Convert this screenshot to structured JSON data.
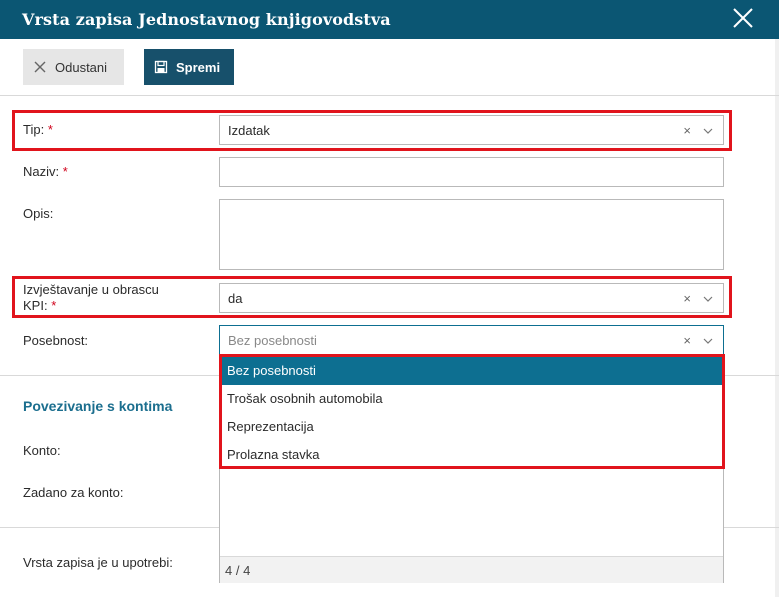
{
  "dialog": {
    "title": "Vrsta zapisa Jednostavnog knjigovodstva"
  },
  "toolbar": {
    "cancel_label": "Odustani",
    "save_label": "Spremi"
  },
  "form": {
    "tip": {
      "label": "Tip:",
      "required": "*",
      "value": "Izdatak",
      "clear": "×"
    },
    "naziv": {
      "label": "Naziv:",
      "required": "*",
      "value": ""
    },
    "opis": {
      "label": "Opis:",
      "value": ""
    },
    "kpi": {
      "label_line1": "Izvještavanje u obrascu",
      "label_line2": "KPI:",
      "required": "*",
      "value": "da",
      "clear": "×"
    },
    "posebnost": {
      "label": "Posebnost:",
      "placeholder": "Bez posebnosti",
      "clear": "×"
    }
  },
  "section": {
    "title": "Povezivanje s kontima",
    "konto_label": "Konto:",
    "zadano_label": "Zadano za konto:",
    "u_upotrebi_label": "Vrsta zapisa je u upotrebi:"
  },
  "dropdown": {
    "options": [
      "Bez posebnosti",
      "Trošak osobnih automobila",
      "Reprezentacija",
      "Prolazna stavka"
    ],
    "selected_index": 0,
    "footer": "4 / 4"
  },
  "colors": {
    "header_bg": "#0b5673",
    "save_bg": "#17506b",
    "accent": "#0d6f91",
    "highlight": "#e1141c",
    "required": "#d0021b"
  }
}
